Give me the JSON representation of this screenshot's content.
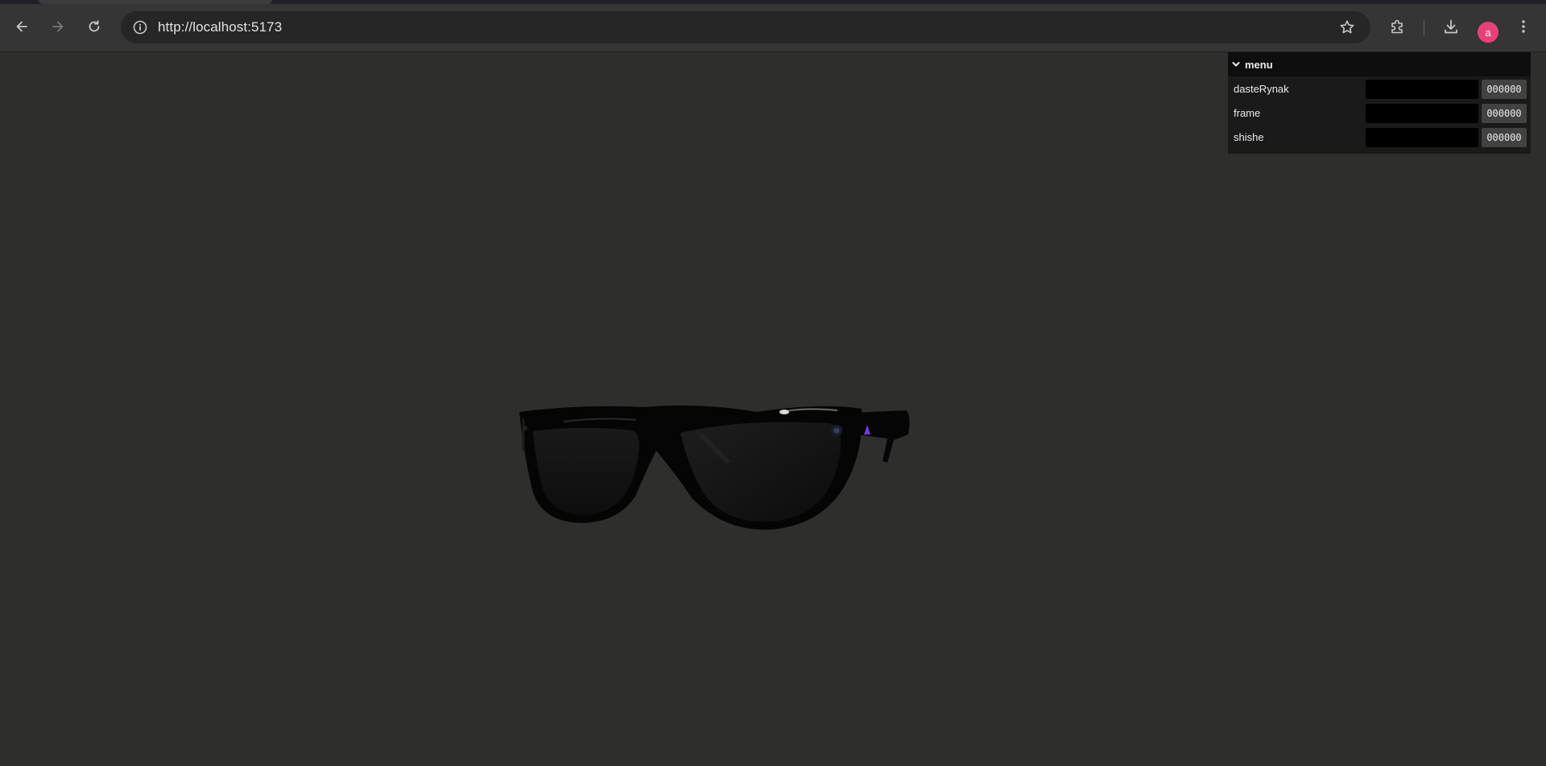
{
  "browser": {
    "url": "http://localhost:5173",
    "profile_initial": "a",
    "icons": {
      "back": "arrow-left-icon",
      "forward": "arrow-right-icon",
      "reload": "reload-icon",
      "site_info": "info-icon",
      "bookmark": "star-icon",
      "extensions": "puzzle-icon",
      "downloads": "download-icon",
      "menu": "kebab-menu-icon"
    },
    "colors": {
      "avatar": "#e8417a"
    }
  },
  "gui": {
    "title": "menu",
    "controls": [
      {
        "label": "dasteRynak",
        "color": "#000000",
        "hex": "000000"
      },
      {
        "label": "frame",
        "color": "#000000",
        "hex": "000000"
      },
      {
        "label": "shishe",
        "color": "#000000",
        "hex": "000000"
      }
    ]
  },
  "scene": {
    "background": "#2e2e2d",
    "object": "sunglasses-3d-model"
  }
}
